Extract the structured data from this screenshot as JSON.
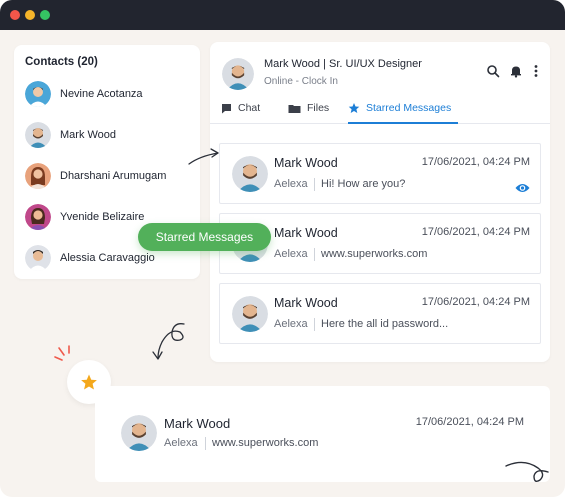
{
  "contacts": {
    "title": "Contacts (20)",
    "items": [
      {
        "name": "Nevine Acotanza",
        "avatar_color": "#4aa6d8"
      },
      {
        "name": "Mark Wood",
        "avatar_color": "#d9dde3"
      },
      {
        "name": "Dharshani Arumugam",
        "avatar_color": "#e8a27c"
      },
      {
        "name": "Yvenide Belizaire",
        "avatar_color": "#c0488a"
      },
      {
        "name": "Alessia Caravaggio",
        "avatar_color": "#dfe2e8"
      }
    ]
  },
  "chat": {
    "header": {
      "name": "Mark Wood | Sr. UI/UX Designer",
      "status": "Online -  Clock In"
    },
    "tabs": [
      {
        "label": "Chat",
        "icon": "chat-icon"
      },
      {
        "label": "Files",
        "icon": "folder-icon"
      },
      {
        "label": "Starred Messages",
        "icon": "star-icon",
        "active": true
      }
    ],
    "messages": [
      {
        "name": "Mark Wood",
        "time": "17/06/2021, 04:24 PM",
        "sender": "Aelexa",
        "text": "Hi! How are you?",
        "has_eye": true
      },
      {
        "name": "Mark Wood",
        "time": "17/06/2021, 04:24 PM",
        "sender": "Aelexa",
        "text": "www.superworks.com",
        "has_eye": false
      },
      {
        "name": "Mark Wood",
        "time": "17/06/2021, 04:24 PM",
        "sender": "Aelexa",
        "text": "Here the all id password...",
        "has_eye": false
      }
    ]
  },
  "pill_label": "Starred Messages",
  "featured": {
    "name": "Mark Wood",
    "time": "17/06/2021, 04:24 PM",
    "sender": "Aelexa",
    "text": "www.superworks.com"
  },
  "colors": {
    "accent": "#1c7ed6",
    "pill": "#52b05a",
    "star": "#f4a81c",
    "titlebar": "#22252f",
    "background": "#f7f3ef"
  }
}
